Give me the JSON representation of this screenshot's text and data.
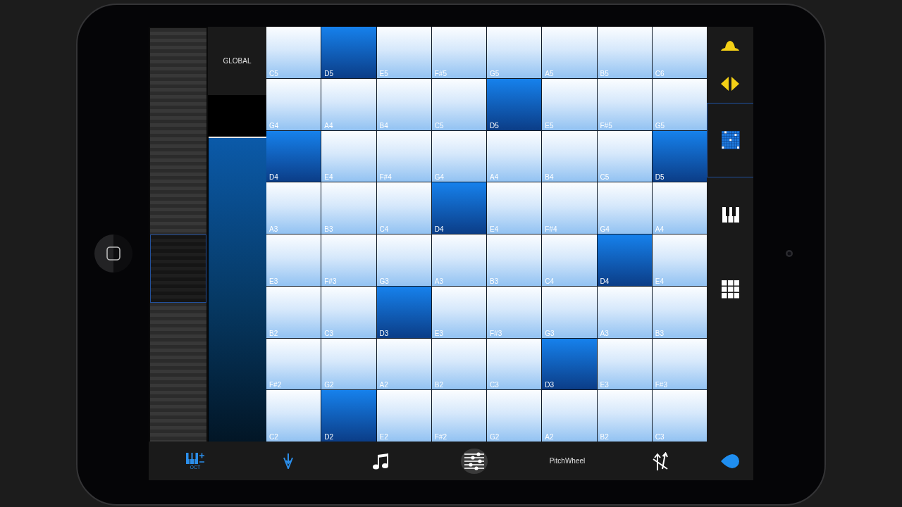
{
  "global": {
    "label": "GLOBAL"
  },
  "slider": {
    "level": 0.88
  },
  "grid": {
    "rows": [
      [
        {
          "note": "C5",
          "highlighted": false
        },
        {
          "note": "D5",
          "highlighted": true
        },
        {
          "note": "E5",
          "highlighted": false
        },
        {
          "note": "F#5",
          "highlighted": false
        },
        {
          "note": "G5",
          "highlighted": false
        },
        {
          "note": "A5",
          "highlighted": false
        },
        {
          "note": "B5",
          "highlighted": false
        },
        {
          "note": "C6",
          "highlighted": false
        }
      ],
      [
        {
          "note": "G4",
          "highlighted": false
        },
        {
          "note": "A4",
          "highlighted": false
        },
        {
          "note": "B4",
          "highlighted": false
        },
        {
          "note": "C5",
          "highlighted": false
        },
        {
          "note": "D5",
          "highlighted": true
        },
        {
          "note": "E5",
          "highlighted": false
        },
        {
          "note": "F#5",
          "highlighted": false
        },
        {
          "note": "G5",
          "highlighted": false
        }
      ],
      [
        {
          "note": "D4",
          "highlighted": true
        },
        {
          "note": "E4",
          "highlighted": false
        },
        {
          "note": "F#4",
          "highlighted": false
        },
        {
          "note": "G4",
          "highlighted": false
        },
        {
          "note": "A4",
          "highlighted": false
        },
        {
          "note": "B4",
          "highlighted": false
        },
        {
          "note": "C5",
          "highlighted": false
        },
        {
          "note": "D5",
          "highlighted": true
        }
      ],
      [
        {
          "note": "A3",
          "highlighted": false
        },
        {
          "note": "B3",
          "highlighted": false
        },
        {
          "note": "C4",
          "highlighted": false
        },
        {
          "note": "D4",
          "highlighted": true
        },
        {
          "note": "E4",
          "highlighted": false
        },
        {
          "note": "F#4",
          "highlighted": false
        },
        {
          "note": "G4",
          "highlighted": false
        },
        {
          "note": "A4",
          "highlighted": false
        }
      ],
      [
        {
          "note": "E3",
          "highlighted": false
        },
        {
          "note": "F#3",
          "highlighted": false
        },
        {
          "note": "G3",
          "highlighted": false
        },
        {
          "note": "A3",
          "highlighted": false
        },
        {
          "note": "B3",
          "highlighted": false
        },
        {
          "note": "C4",
          "highlighted": false
        },
        {
          "note": "D4",
          "highlighted": true
        },
        {
          "note": "E4",
          "highlighted": false
        }
      ],
      [
        {
          "note": "B2",
          "highlighted": false
        },
        {
          "note": "C3",
          "highlighted": false
        },
        {
          "note": "D3",
          "highlighted": true
        },
        {
          "note": "E3",
          "highlighted": false
        },
        {
          "note": "F#3",
          "highlighted": false
        },
        {
          "note": "G3",
          "highlighted": false
        },
        {
          "note": "A3",
          "highlighted": false
        },
        {
          "note": "B3",
          "highlighted": false
        }
      ],
      [
        {
          "note": "F#2",
          "highlighted": false
        },
        {
          "note": "G2",
          "highlighted": false
        },
        {
          "note": "A2",
          "highlighted": false
        },
        {
          "note": "B2",
          "highlighted": false
        },
        {
          "note": "C3",
          "highlighted": false
        },
        {
          "note": "D3",
          "highlighted": true
        },
        {
          "note": "E3",
          "highlighted": false
        },
        {
          "note": "F#3",
          "highlighted": false
        }
      ],
      [
        {
          "note": "C2",
          "highlighted": false
        },
        {
          "note": "D2",
          "highlighted": true
        },
        {
          "note": "E2",
          "highlighted": false
        },
        {
          "note": "F#2",
          "highlighted": false
        },
        {
          "note": "G2",
          "highlighted": false
        },
        {
          "note": "A2",
          "highlighted": false
        },
        {
          "note": "B2",
          "highlighted": false
        },
        {
          "note": "C3",
          "highlighted": false
        }
      ]
    ]
  },
  "sidebar": {
    "buttons": [
      {
        "kind": "dome"
      },
      {
        "kind": "arrows"
      }
    ],
    "modes": [
      {
        "kind": "grid",
        "selected": true
      },
      {
        "kind": "keyboard",
        "selected": false
      },
      {
        "kind": "pads",
        "selected": false
      }
    ]
  },
  "toolbar": [
    {
      "kind": "octave",
      "label": "OCT",
      "selected": false
    },
    {
      "kind": "velocity",
      "selected": false
    },
    {
      "kind": "notes",
      "selected": false
    },
    {
      "kind": "mixer",
      "selected": true
    },
    {
      "kind": "text",
      "label": "PitchWheel",
      "selected": false
    },
    {
      "kind": "transpose",
      "selected": false
    },
    {
      "kind": "drop",
      "selected": false
    }
  ]
}
